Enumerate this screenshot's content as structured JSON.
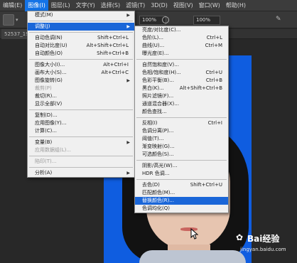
{
  "menubar": {
    "items": [
      {
        "label": "编辑(E)",
        "active": false
      },
      {
        "label": "图像(I)",
        "active": true
      },
      {
        "label": "图层(L)",
        "active": false
      },
      {
        "label": "文字(Y)",
        "active": false
      },
      {
        "label": "选择(S)",
        "active": false
      },
      {
        "label": "滤镜(T)",
        "active": false
      },
      {
        "label": "3D(D)",
        "active": false
      },
      {
        "label": "视图(V)",
        "active": false
      },
      {
        "label": "窗口(W)",
        "active": false
      },
      {
        "label": "帮助(H)",
        "active": false
      }
    ]
  },
  "options": {
    "zoom1": "100%",
    "zoom2": "100%"
  },
  "doctab": {
    "label": "52537_19"
  },
  "image_menu": {
    "items": [
      {
        "type": "item",
        "label": "模式(M)",
        "shortcut": "",
        "submenu": true,
        "disabled": false,
        "highlighted": false
      },
      {
        "type": "sep"
      },
      {
        "type": "item",
        "label": "调整(J)",
        "shortcut": "",
        "submenu": true,
        "disabled": false,
        "highlighted": true
      },
      {
        "type": "sep"
      },
      {
        "type": "item",
        "label": "自动色调(N)",
        "shortcut": "Shift+Ctrl+L",
        "submenu": false,
        "disabled": false,
        "highlighted": false
      },
      {
        "type": "item",
        "label": "自动对比度(U)",
        "shortcut": "Alt+Shift+Ctrl+L",
        "submenu": false,
        "disabled": false,
        "highlighted": false
      },
      {
        "type": "item",
        "label": "自动颜色(O)",
        "shortcut": "Shift+Ctrl+B",
        "submenu": false,
        "disabled": false,
        "highlighted": false
      },
      {
        "type": "sep"
      },
      {
        "type": "item",
        "label": "图像大小(I)...",
        "shortcut": "Alt+Ctrl+I",
        "submenu": false,
        "disabled": false,
        "highlighted": false
      },
      {
        "type": "item",
        "label": "画布大小(S)...",
        "shortcut": "Alt+Ctrl+C",
        "submenu": false,
        "disabled": false,
        "highlighted": false
      },
      {
        "type": "item",
        "label": "图像旋转(G)",
        "shortcut": "",
        "submenu": true,
        "disabled": false,
        "highlighted": false
      },
      {
        "type": "item",
        "label": "裁剪(P)",
        "shortcut": "",
        "submenu": false,
        "disabled": true,
        "highlighted": false
      },
      {
        "type": "item",
        "label": "裁切(R)...",
        "shortcut": "",
        "submenu": false,
        "disabled": false,
        "highlighted": false
      },
      {
        "type": "item",
        "label": "显示全部(V)",
        "shortcut": "",
        "submenu": false,
        "disabled": false,
        "highlighted": false
      },
      {
        "type": "sep"
      },
      {
        "type": "item",
        "label": "复制(D)...",
        "shortcut": "",
        "submenu": false,
        "disabled": false,
        "highlighted": false
      },
      {
        "type": "item",
        "label": "应用图像(Y)...",
        "shortcut": "",
        "submenu": false,
        "disabled": false,
        "highlighted": false
      },
      {
        "type": "item",
        "label": "计算(C)...",
        "shortcut": "",
        "submenu": false,
        "disabled": false,
        "highlighted": false
      },
      {
        "type": "sep"
      },
      {
        "type": "item",
        "label": "变量(B)",
        "shortcut": "",
        "submenu": true,
        "disabled": false,
        "highlighted": false
      },
      {
        "type": "item",
        "label": "应用数据组(L)...",
        "shortcut": "",
        "submenu": false,
        "disabled": true,
        "highlighted": false
      },
      {
        "type": "sep"
      },
      {
        "type": "item",
        "label": "陷印(T)...",
        "shortcut": "",
        "submenu": false,
        "disabled": true,
        "highlighted": false
      },
      {
        "type": "sep"
      },
      {
        "type": "item",
        "label": "分析(A)",
        "shortcut": "",
        "submenu": true,
        "disabled": false,
        "highlighted": false
      }
    ]
  },
  "adjust_menu": {
    "items": [
      {
        "type": "item",
        "label": "亮度/对比度(C)...",
        "shortcut": "",
        "highlighted": false
      },
      {
        "type": "item",
        "label": "色阶(L)...",
        "shortcut": "Ctrl+L",
        "highlighted": false
      },
      {
        "type": "item",
        "label": "曲线(U)...",
        "shortcut": "Ctrl+M",
        "highlighted": false
      },
      {
        "type": "item",
        "label": "曝光度(E)...",
        "shortcut": "",
        "highlighted": false
      },
      {
        "type": "sep"
      },
      {
        "type": "item",
        "label": "自然饱和度(V)...",
        "shortcut": "",
        "highlighted": false
      },
      {
        "type": "item",
        "label": "色相/饱和度(H)...",
        "shortcut": "Ctrl+U",
        "highlighted": false
      },
      {
        "type": "item",
        "label": "色彩平衡(B)...",
        "shortcut": "Ctrl+B",
        "highlighted": false
      },
      {
        "type": "item",
        "label": "黑白(K)...",
        "shortcut": "Alt+Shift+Ctrl+B",
        "highlighted": false
      },
      {
        "type": "item",
        "label": "照片滤镜(F)...",
        "shortcut": "",
        "highlighted": false
      },
      {
        "type": "item",
        "label": "通道混合器(X)...",
        "shortcut": "",
        "highlighted": false
      },
      {
        "type": "item",
        "label": "颜色查找...",
        "shortcut": "",
        "highlighted": false
      },
      {
        "type": "sep"
      },
      {
        "type": "item",
        "label": "反相(I)",
        "shortcut": "Ctrl+I",
        "highlighted": false
      },
      {
        "type": "item",
        "label": "色调分离(P)...",
        "shortcut": "",
        "highlighted": false
      },
      {
        "type": "item",
        "label": "阈值(T)...",
        "shortcut": "",
        "highlighted": false
      },
      {
        "type": "item",
        "label": "渐变映射(G)...",
        "shortcut": "",
        "highlighted": false
      },
      {
        "type": "item",
        "label": "可选颜色(S)...",
        "shortcut": "",
        "highlighted": false
      },
      {
        "type": "sep"
      },
      {
        "type": "item",
        "label": "阴影/高光(W)...",
        "shortcut": "",
        "highlighted": false
      },
      {
        "type": "item",
        "label": "HDR 色调...",
        "shortcut": "",
        "highlighted": false
      },
      {
        "type": "sep"
      },
      {
        "type": "item",
        "label": "去色(D)",
        "shortcut": "Shift+Ctrl+U",
        "highlighted": false
      },
      {
        "type": "item",
        "label": "匹配颜色(M)...",
        "shortcut": "",
        "highlighted": false
      },
      {
        "type": "item",
        "label": "替换颜色(R)...",
        "shortcut": "",
        "highlighted": true
      },
      {
        "type": "item",
        "label": "色调均化(Q)",
        "shortcut": "",
        "highlighted": false
      }
    ]
  },
  "watermark": {
    "logo": "Bai经验",
    "url": "jingyan.baidu.com"
  },
  "colors": {
    "highlight": "#1a66d8",
    "photo_background": "#0f5de0"
  }
}
